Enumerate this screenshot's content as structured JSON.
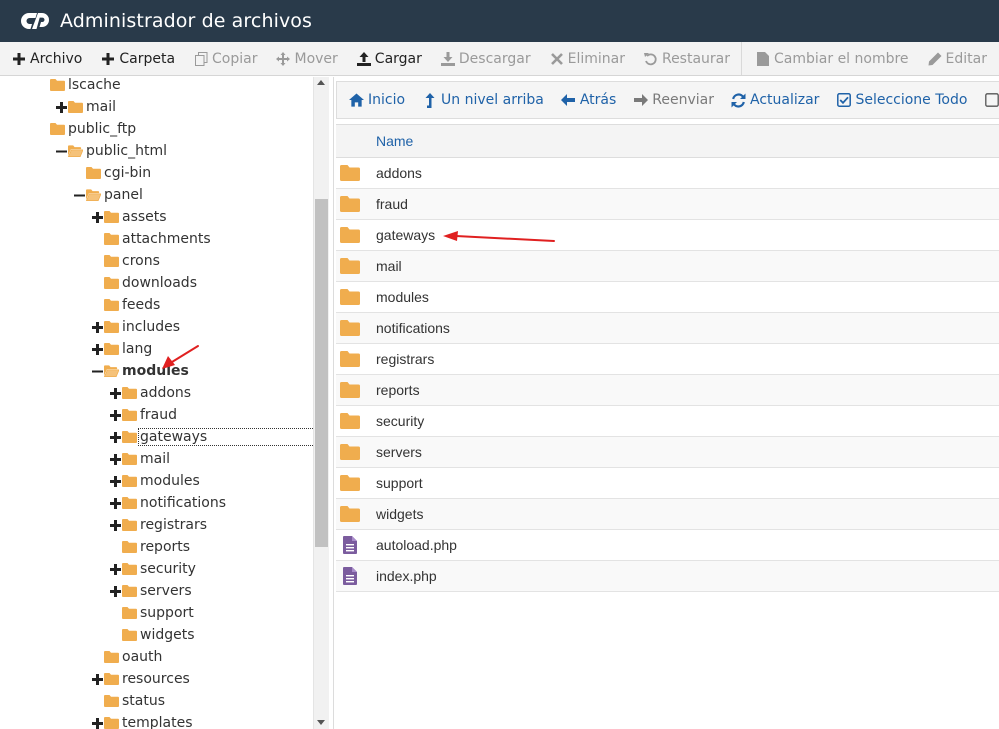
{
  "header": {
    "title": "Administrador de archivos"
  },
  "toolbar": {
    "buttons": [
      {
        "label": "Archivo",
        "icon": "plus-icon",
        "enabled": true
      },
      {
        "label": "Carpeta",
        "icon": "plus-icon",
        "enabled": true
      },
      {
        "label": "Copiar",
        "icon": "copy-icon",
        "enabled": false
      },
      {
        "label": "Mover",
        "icon": "move-icon",
        "enabled": false
      },
      {
        "label": "Cargar",
        "icon": "upload-icon",
        "enabled": true
      },
      {
        "label": "Descargar",
        "icon": "download-icon",
        "enabled": false
      },
      {
        "label": "Eliminar",
        "icon": "close-icon",
        "enabled": false
      },
      {
        "label": "Restaurar",
        "icon": "undo-icon",
        "enabled": false
      },
      {
        "label": "Cambiar el nombre",
        "icon": "file-icon",
        "enabled": false
      },
      {
        "label": "Editar",
        "icon": "pencil-icon",
        "enabled": false
      }
    ]
  },
  "tree": {
    "items": [
      {
        "label": "lscache",
        "toggle": "none",
        "open": false
      },
      {
        "label": "mail",
        "toggle": "plus",
        "open": false
      },
      {
        "label": "public_ftp",
        "toggle": "none",
        "open": false
      },
      {
        "label": "public_html",
        "toggle": "minus",
        "open": true
      },
      {
        "label": "cgi-bin",
        "toggle": "none",
        "open": false
      },
      {
        "label": "panel",
        "toggle": "minus",
        "open": true
      },
      {
        "label": "assets",
        "toggle": "plus",
        "open": false
      },
      {
        "label": "attachments",
        "toggle": "none",
        "open": false
      },
      {
        "label": "crons",
        "toggle": "none",
        "open": false
      },
      {
        "label": "downloads",
        "toggle": "none",
        "open": false
      },
      {
        "label": "feeds",
        "toggle": "none",
        "open": false
      },
      {
        "label": "includes",
        "toggle": "plus",
        "open": false
      },
      {
        "label": "lang",
        "toggle": "plus",
        "open": false
      },
      {
        "label": "modules",
        "toggle": "minus",
        "open": true,
        "bold": true
      },
      {
        "label": "addons",
        "toggle": "plus",
        "open": false
      },
      {
        "label": "fraud",
        "toggle": "plus",
        "open": false
      },
      {
        "label": "gateways",
        "toggle": "plus",
        "open": false,
        "selected": true
      },
      {
        "label": "mail",
        "toggle": "plus",
        "open": false
      },
      {
        "label": "modules",
        "toggle": "plus",
        "open": false
      },
      {
        "label": "notifications",
        "toggle": "plus",
        "open": false
      },
      {
        "label": "registrars",
        "toggle": "plus",
        "open": false
      },
      {
        "label": "reports",
        "toggle": "none",
        "open": false
      },
      {
        "label": "security",
        "toggle": "plus",
        "open": false
      },
      {
        "label": "servers",
        "toggle": "plus",
        "open": false
      },
      {
        "label": "support",
        "toggle": "none",
        "open": false
      },
      {
        "label": "widgets",
        "toggle": "none",
        "open": false
      },
      {
        "label": "oauth",
        "toggle": "none",
        "open": false
      },
      {
        "label": "resources",
        "toggle": "plus",
        "open": false
      },
      {
        "label": "status",
        "toggle": "none",
        "open": false
      },
      {
        "label": "templates",
        "toggle": "plus",
        "open": false
      }
    ]
  },
  "navbar": {
    "buttons": [
      {
        "label": "Inicio",
        "icon": "home-icon",
        "enabled": true
      },
      {
        "label": "Un nivel arriba",
        "icon": "level-up-icon",
        "enabled": true
      },
      {
        "label": "Atrás",
        "icon": "arrow-left-icon",
        "enabled": true
      },
      {
        "label": "Reenviar",
        "icon": "arrow-right-icon",
        "enabled": false
      },
      {
        "label": "Actualizar",
        "icon": "refresh-icon",
        "enabled": true
      },
      {
        "label": "Seleccione Todo",
        "icon": "checkbox-checked-icon",
        "enabled": true
      },
      {
        "label": "",
        "icon": "checkbox-empty-icon",
        "enabled": true
      }
    ]
  },
  "table": {
    "header": {
      "name": "Name"
    },
    "rows": [
      {
        "name": "addons",
        "type": "folder"
      },
      {
        "name": "fraud",
        "type": "folder"
      },
      {
        "name": "gateways",
        "type": "folder"
      },
      {
        "name": "mail",
        "type": "folder"
      },
      {
        "name": "modules",
        "type": "folder"
      },
      {
        "name": "notifications",
        "type": "folder"
      },
      {
        "name": "registrars",
        "type": "folder"
      },
      {
        "name": "reports",
        "type": "folder"
      },
      {
        "name": "security",
        "type": "folder"
      },
      {
        "name": "servers",
        "type": "folder"
      },
      {
        "name": "support",
        "type": "folder"
      },
      {
        "name": "widgets",
        "type": "folder"
      },
      {
        "name": "autoload.php",
        "type": "file"
      },
      {
        "name": "index.php",
        "type": "file"
      }
    ]
  },
  "colors": {
    "header_bg": "#293a4a",
    "folder": "#f0ad4e",
    "file": "#7b5c9e",
    "link": "#1f62a8",
    "annotation_arrow": "#e02020"
  }
}
